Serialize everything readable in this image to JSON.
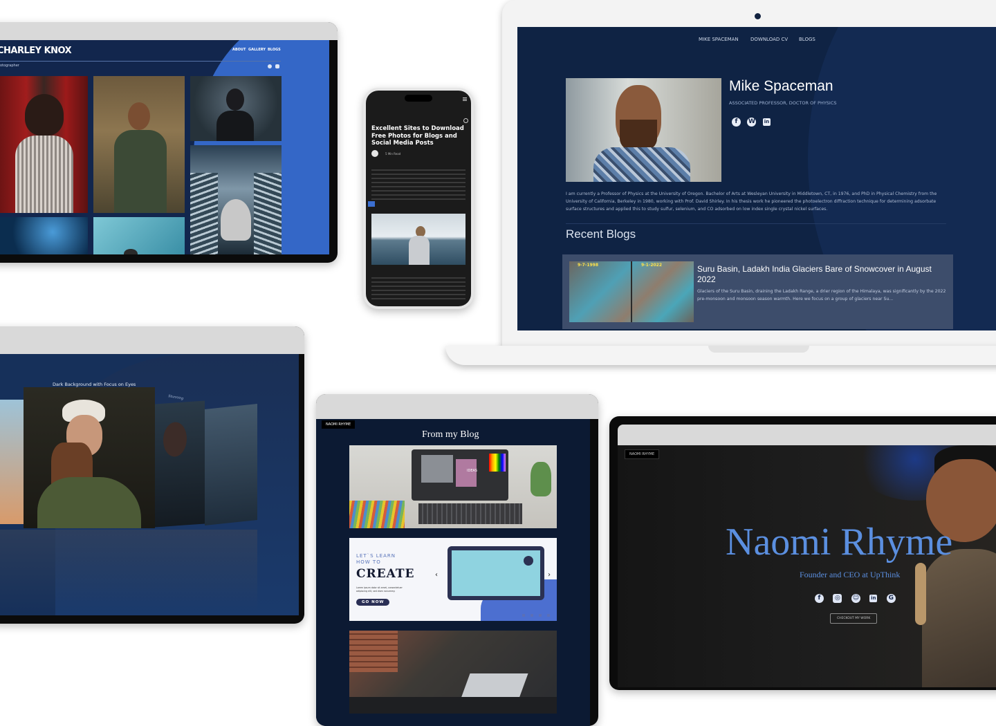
{
  "charley": {
    "brand": "CHARLEY KNOX",
    "subtitle": "otographer",
    "nav": [
      "ABOUT",
      "GALLERY",
      "BLOGS"
    ]
  },
  "phone": {
    "title": "Excellent Sites to Download Free Photos for Blogs and Social Media Posts",
    "read_time": "5 Min Read"
  },
  "mike": {
    "nav": [
      "MIKE SPACEMAN",
      "DOWNLOAD CV",
      "BLOGS"
    ],
    "name": "Mike Spaceman",
    "role": "ASSOCIATED PROFESSOR, DOCTOR OF PHYSICS",
    "bio": "I am currently a Professor of Physics at the University of Oregon. Bachelor of Arts at Wesleyan University in Middletown, CT, in 1976, and PhD in Physical Chemistry from the University of California, Berkeley in 1980, working with Prof. David Shirley. In his thesis work he pioneered the photoelectron diffraction technique for determining adsorbate surface structures and applied this to study sulfur, selenium, and CO adsorbed on low index single crystal nickel surfaces.",
    "recent_heading": "Recent Blogs",
    "blog": {
      "title": "Suru Basin, Ladakh India Glaciers Bare of Snowcover in August 2022",
      "excerpt": "Glaciers of the Suru Basin, draining the Ladakh Range, a drier region of the Himalaya, was significantly by the 2022 pre-monsoon and monsoon season warmth. Here we focus on a group of glaciers near Su...",
      "date_left": "9-7-1998",
      "date_right": "9-1-2022"
    },
    "social_icons": [
      "facebook-icon",
      "wordpress-icon",
      "linkedin-icon"
    ]
  },
  "gallery": {
    "caption": "Dark Background with Focus on Eyes",
    "side_caption": "Stunning"
  },
  "naomi_blog": {
    "badge": "NAOMI RHYME",
    "heading": "From my Blog",
    "card2": {
      "line1": "LET`S LEARN",
      "line2": "HOW TO",
      "big": "CREATE",
      "body": "Lorem ipsum dolor sit amet, consectetuer adipiscing elit, sed diam nonummy.",
      "cta": "GO NOW"
    },
    "card1_sign": "IDEAS"
  },
  "naomi_hero": {
    "badge": "NAOMI RHYME",
    "name": "Naomi Rhyme",
    "tagline": "Founder and CEO at UpThink",
    "button": "CHECKOUT MY WORK",
    "social_icons": [
      "facebook-icon",
      "instagram-icon",
      "snapchat-icon",
      "linkedin-icon",
      "google-icon"
    ]
  },
  "colors": {
    "navy": "#13284f",
    "deep_navy": "#0d1a33",
    "accent_blue": "#3b6fd1",
    "naomi_blue": "#5b8fe0"
  }
}
